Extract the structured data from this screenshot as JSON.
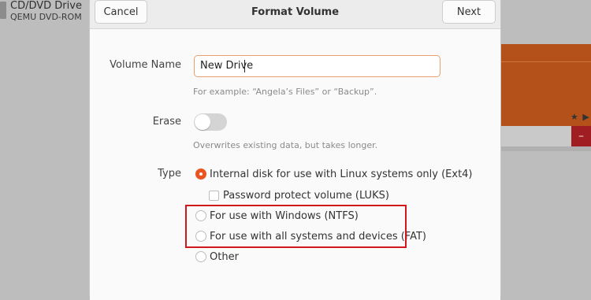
{
  "background": {
    "device_title": "CD/DVD Drive",
    "device_subtitle": "QEMU DVD-ROM",
    "play_glyphs": "★ ▶",
    "minus_label": "–"
  },
  "dialog": {
    "title": "Format Volume",
    "cancel_label": "Cancel",
    "next_label": "Next",
    "volume_name": {
      "label": "Volume Name",
      "value": "New Drive",
      "hint": "For example: “Angela’s Files” or “Backup”."
    },
    "erase": {
      "label": "Erase",
      "enabled": false,
      "hint": "Overwrites existing data, but takes longer."
    },
    "type": {
      "label": "Type",
      "options": [
        {
          "label": "Internal disk for use with Linux systems only (Ext4)",
          "selected": true
        },
        {
          "label": "For use with Windows (NTFS)",
          "selected": false
        },
        {
          "label": "For use with all systems and devices (FAT)",
          "selected": false
        },
        {
          "label": "Other",
          "selected": false
        }
      ],
      "luks_label": "Password protect volume (LUKS)",
      "luks_checked": false
    }
  },
  "colors": {
    "accent": "#e95420",
    "highlight": "#d0181a"
  }
}
